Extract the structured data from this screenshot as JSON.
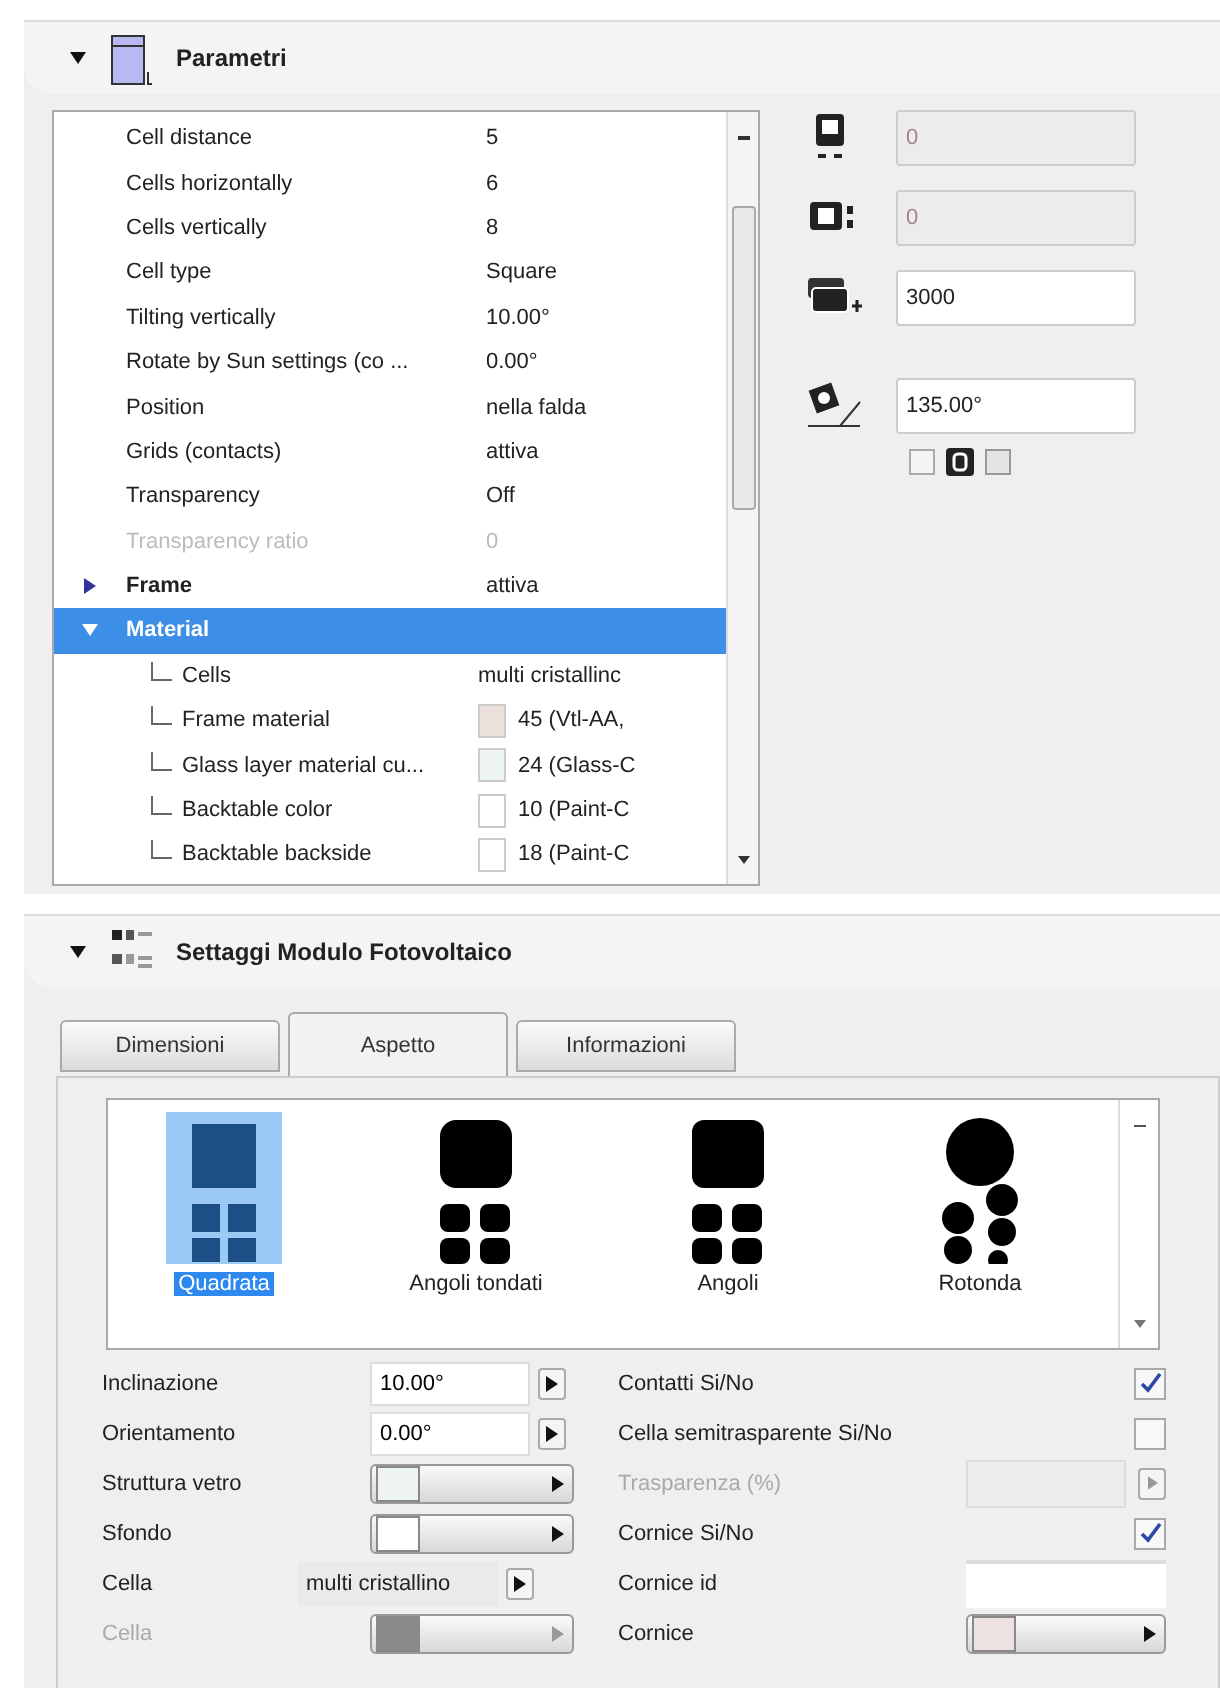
{
  "parameters_panel": {
    "title": "Parametri",
    "expanded": true,
    "rows": [
      {
        "label": "Cell distance",
        "value": "5",
        "disabled": false,
        "selected": false
      },
      {
        "label": "Cells horizontally",
        "value": "6",
        "disabled": false,
        "selected": false
      },
      {
        "label": "Cells vertically",
        "value": "8",
        "disabled": false,
        "selected": false
      },
      {
        "label": "Cell type",
        "value": "Square",
        "disabled": false,
        "selected": false
      },
      {
        "label": "Tilting vertically",
        "value": "10.00°",
        "disabled": false,
        "selected": false
      },
      {
        "label": "Rotate by Sun settings (co ...",
        "value": "0.00°",
        "disabled": false,
        "selected": false
      },
      {
        "label": "Position",
        "value": "nella falda",
        "disabled": false,
        "selected": false
      },
      {
        "label": "Grids (contacts)",
        "value": "attiva",
        "disabled": false,
        "selected": false
      },
      {
        "label": "Transparency",
        "value": "Off",
        "disabled": false,
        "selected": false
      },
      {
        "label": "Transparency ratio",
        "value": "0",
        "disabled": true,
        "selected": false
      },
      {
        "label": "Frame",
        "value": "attiva",
        "disabled": false,
        "selected": false,
        "expanded": false
      },
      {
        "label": "Material",
        "disabled": false,
        "selected": true,
        "expanded": true,
        "children": [
          {
            "label": "Cells",
            "value": "multi cristallinc",
            "disabled": false,
            "selected": false
          },
          {
            "label": "Frame material",
            "value": "45 (Vtl-AA,",
            "color": "#ece0dd",
            "disabled": false,
            "selected": false
          },
          {
            "label": "Glass layer material cu...",
            "value": "24 (Glass-C",
            "color": "#eef4ef",
            "disabled": false,
            "selected": false
          },
          {
            "label": "Backtable color",
            "value": "10 (Paint-C",
            "color": "#ffffff",
            "disabled": false,
            "selected": false
          },
          {
            "label": "Backtable backside",
            "value": "18 (Paint-C",
            "color": "#ffffff",
            "disabled": false,
            "selected": false
          }
        ]
      }
    ],
    "side_fields": [
      {
        "value": "0",
        "disabled": true
      },
      {
        "value": "0",
        "disabled": true
      },
      {
        "value": "3000",
        "disabled": false
      },
      {
        "value": "135.00°",
        "disabled": false
      }
    ]
  },
  "module_panel": {
    "title": "Settaggi Modulo Fotovoltaico",
    "expanded": true,
    "tabs": [
      {
        "label": "Dimensioni",
        "selected": false
      },
      {
        "label": "Aspetto",
        "selected": true
      },
      {
        "label": "Informazioni",
        "selected": false
      }
    ],
    "shapes": [
      {
        "kind": "square",
        "label": "Quadrata",
        "selected": true
      },
      {
        "kind": "rounded",
        "label": "Angoli tondati",
        "selected": false
      },
      {
        "kind": "chamfered",
        "label": "Angoli",
        "selected": false
      },
      {
        "kind": "round",
        "label": "Rotonda",
        "selected": false
      }
    ],
    "left_settings": [
      {
        "kind": "number",
        "label": "Inclinazione",
        "value": "10.00°",
        "disabled": false
      },
      {
        "kind": "number",
        "label": "Orientamento",
        "value": "0.00°",
        "disabled": false
      },
      {
        "kind": "swatch",
        "label": "Struttura vetro",
        "color": "#eef4ef",
        "disabled": false
      },
      {
        "kind": "swatch",
        "label": "Sfondo",
        "color": "#ffffff",
        "disabled": false
      },
      {
        "kind": "text",
        "label": "Cella",
        "value": "multi cristallino",
        "disabled": false
      },
      {
        "kind": "swatch",
        "label": "Cella",
        "color": "#8a8a8a",
        "disabled": true
      }
    ],
    "right_settings": [
      {
        "kind": "check",
        "label": "Contatti Si/No",
        "checked": true,
        "disabled": false
      },
      {
        "kind": "check",
        "label": "Cella semitrasparente Si/No",
        "checked": false,
        "disabled": false
      },
      {
        "kind": "field",
        "label": "Trasparenza (%)",
        "disabled": true
      },
      {
        "kind": "check",
        "label": "Cornice Si/No",
        "checked": true,
        "disabled": false
      },
      {
        "kind": "plain",
        "label": "Cornice id",
        "disabled": false
      },
      {
        "kind": "swatch",
        "label": "Cornice",
        "color": "#ede2df",
        "disabled": false
      }
    ]
  }
}
